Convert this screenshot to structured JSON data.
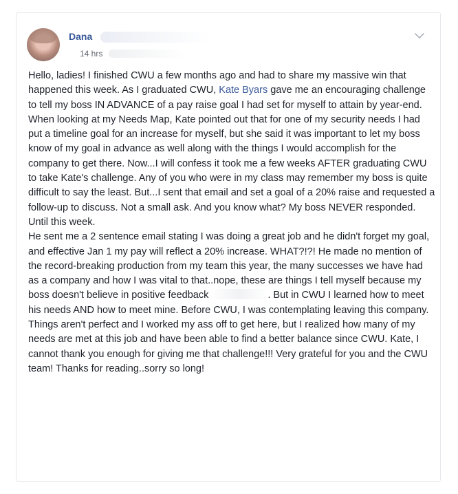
{
  "post": {
    "author_name": "Dana",
    "timestamp": "14 hrs",
    "colors": {
      "link": "#385898",
      "text": "#1d2129",
      "meta": "#616770"
    },
    "icons": {
      "menu": "chevron-down-icon",
      "avatar": "profile-photo"
    },
    "body": {
      "p1_part1": "Hello, ladies! I finished CWU a few months ago and had to share my massive win that happened this week. As I graduated CWU, ",
      "p1_link": "Kate Byars",
      "p1_part2": " gave me an encouraging challenge to tell my boss IN ADVANCE of a pay raise goal I had set for myself to attain by year-end. When looking at my Needs Map, Kate pointed out that for one of my security needs I had put a timeline goal for an increase for myself, but she said it was important to let my boss know of my goal in advance as well along with the things I would accomplish for the company to get there. Now...I will confess it took me a few weeks AFTER graduating CWU to take Kate's challenge. Any of you who were in my class may remember my boss is quite difficult to say the least. But...I sent that email and set a goal of a 20% raise and requested a follow-up to discuss. Not a small ask. And you know what? My boss NEVER responded. Until this week.",
      "p2_part1": "He sent me a 2 sentence email stating I was doing a great job and he didn't forget my goal, and effective Jan 1 my pay will reflect a 20% increase. WHAT?!?! He made no mention of the record-breaking production from my team this year, the many successes we have had as a company and how I was vital to that..nope, these are things I tell myself because my boss doesn't believe in positive feedback ",
      "p2_part2": ". But in CWU I learned how to meet his needs AND how to meet mine. Before CWU, I was contemplating leaving this company. Things aren't perfect and I worked my ass off to get here, but I realized how many of my needs are met at this job and have been able to find a better balance since CWU. Kate, I cannot thank you enough for giving me that challenge!!! Very grateful for you and the CWU team! Thanks for reading..sorry so long!"
    }
  }
}
